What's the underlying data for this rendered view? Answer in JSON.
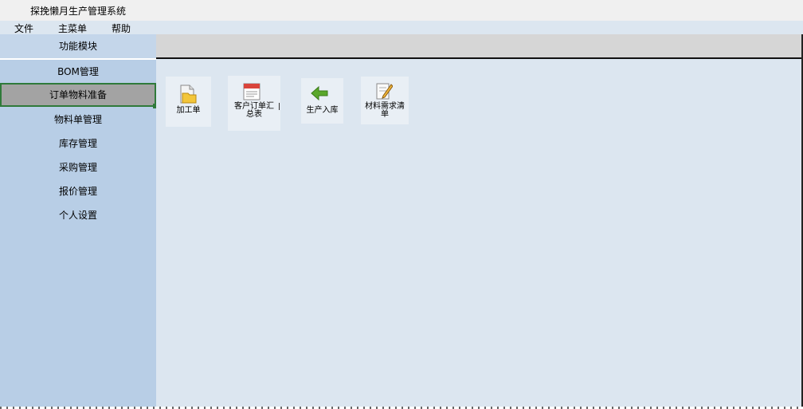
{
  "window": {
    "title": "探挽懒月生产管理系统"
  },
  "menu": {
    "file": "文件",
    "main_menu": "主菜单",
    "help": "帮助"
  },
  "sidebar": {
    "header": "功能模块",
    "items": [
      {
        "label": "BOM管理"
      },
      {
        "label": "订单物料准备"
      },
      {
        "label": "物料单管理"
      },
      {
        "label": "库存管理"
      },
      {
        "label": "采购管理"
      },
      {
        "label": "报价管理"
      },
      {
        "label": "个人设置"
      }
    ],
    "active_index": 1
  },
  "tiles": [
    {
      "label": "加工单",
      "icon": "folder-document-icon"
    },
    {
      "label": "客户订单汇总表",
      "icon": "calendar-icon"
    },
    {
      "label": "生产入库",
      "icon": "green-arrow-left-icon"
    },
    {
      "label": "材料需求清单",
      "icon": "edit-note-icon"
    }
  ]
}
